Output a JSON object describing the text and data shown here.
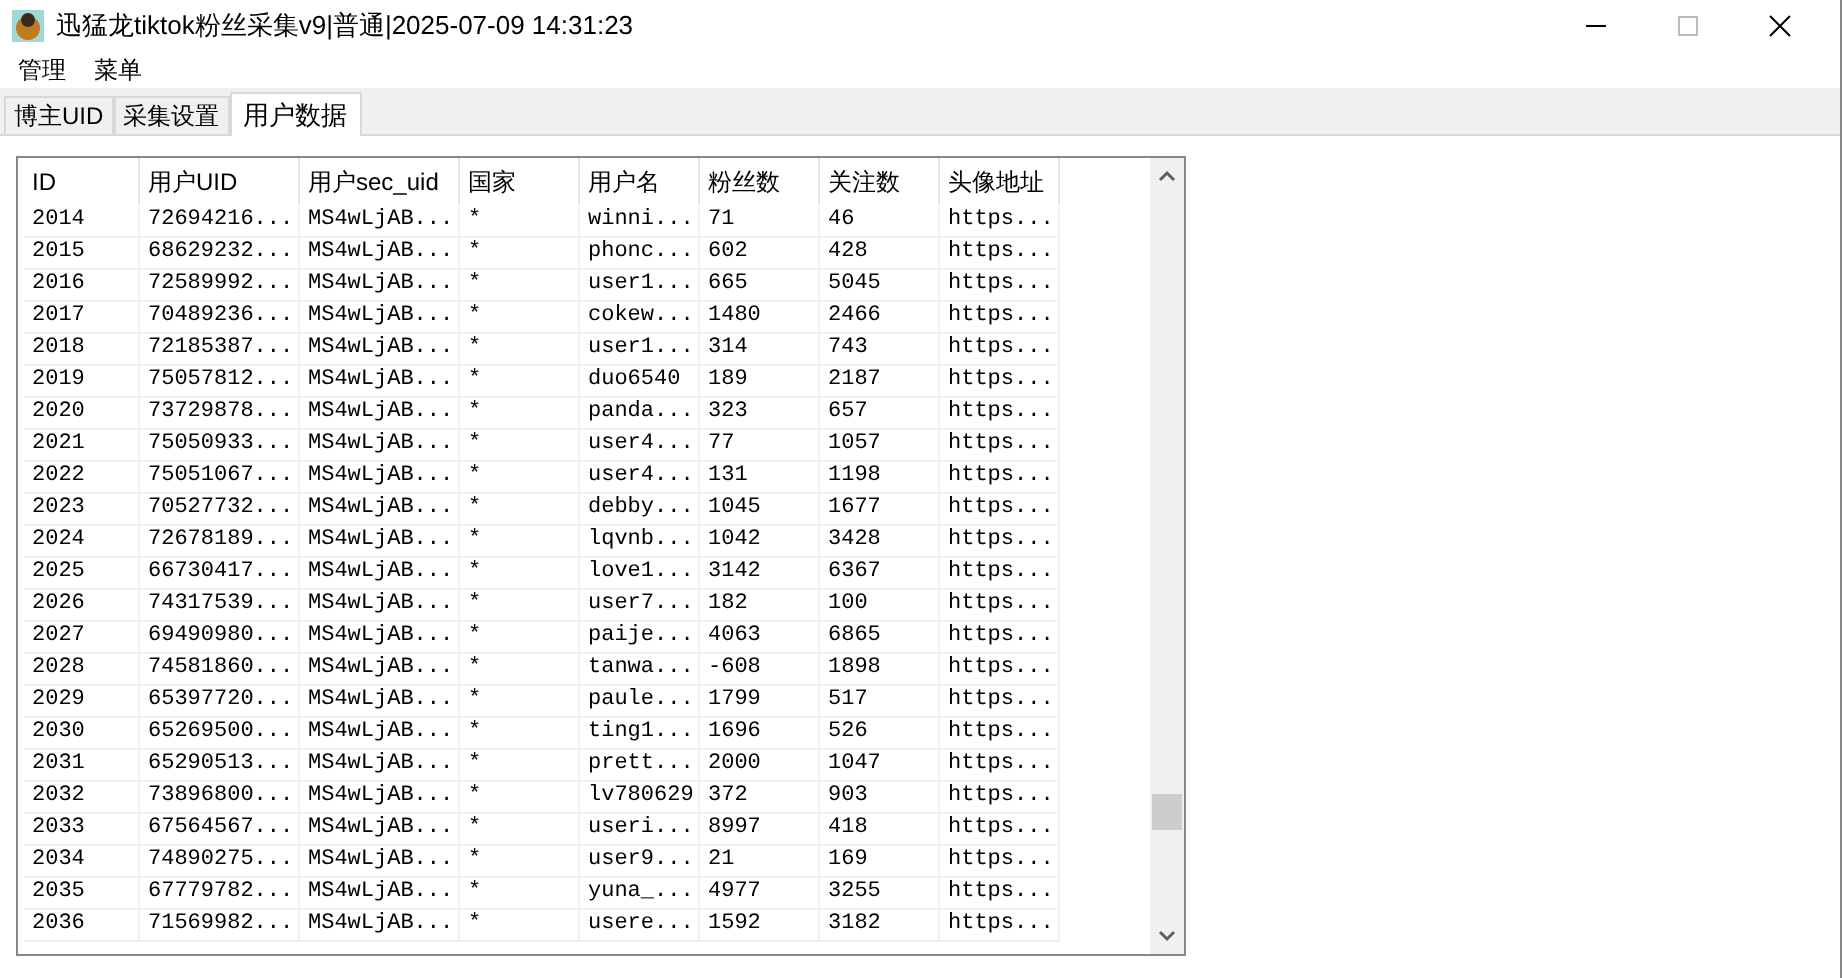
{
  "window": {
    "title": "迅猛龙tiktok粉丝采集v9|普通|2025-07-09 14:31:23"
  },
  "menu": [
    "管理",
    "菜单"
  ],
  "tabs": [
    {
      "label": "博主UID",
      "selected": false
    },
    {
      "label": "采集设置",
      "selected": false
    },
    {
      "label": "用户数据",
      "selected": true
    }
  ],
  "table": {
    "columns": [
      "ID",
      "用户UID",
      "用户sec_uid",
      "国家",
      "用户名",
      "粉丝数",
      "关注数",
      "头像地址"
    ],
    "rows": [
      [
        "2014",
        "72694216...",
        "MS4wLjAB...",
        "*",
        "winni...",
        "71",
        "46",
        "https..."
      ],
      [
        "2015",
        "68629232...",
        "MS4wLjAB...",
        "*",
        "phonc...",
        "602",
        "428",
        "https..."
      ],
      [
        "2016",
        "72589992...",
        "MS4wLjAB...",
        "*",
        "user1...",
        "665",
        "5045",
        "https..."
      ],
      [
        "2017",
        "70489236...",
        "MS4wLjAB...",
        "*",
        "cokew...",
        "1480",
        "2466",
        "https..."
      ],
      [
        "2018",
        "72185387...",
        "MS4wLjAB...",
        "*",
        "user1...",
        "314",
        "743",
        "https..."
      ],
      [
        "2019",
        "75057812...",
        "MS4wLjAB...",
        "*",
        "duo6540",
        "189",
        "2187",
        "https..."
      ],
      [
        "2020",
        "73729878...",
        "MS4wLjAB...",
        "*",
        "panda...",
        "323",
        "657",
        "https..."
      ],
      [
        "2021",
        "75050933...",
        "MS4wLjAB...",
        "*",
        "user4...",
        "77",
        "1057",
        "https..."
      ],
      [
        "2022",
        "75051067...",
        "MS4wLjAB...",
        "*",
        "user4...",
        "131",
        "1198",
        "https..."
      ],
      [
        "2023",
        "70527732...",
        "MS4wLjAB...",
        "*",
        "debby...",
        "1045",
        "1677",
        "https..."
      ],
      [
        "2024",
        "72678189...",
        "MS4wLjAB...",
        "*",
        "lqvnb...",
        "1042",
        "3428",
        "https..."
      ],
      [
        "2025",
        "66730417...",
        "MS4wLjAB...",
        "*",
        "love1...",
        "3142",
        "6367",
        "https..."
      ],
      [
        "2026",
        "74317539...",
        "MS4wLjAB...",
        "*",
        "user7...",
        "182",
        "100",
        "https..."
      ],
      [
        "2027",
        "69490980...",
        "MS4wLjAB...",
        "*",
        "paije...",
        "4063",
        "6865",
        "https..."
      ],
      [
        "2028",
        "74581860...",
        "MS4wLjAB...",
        "*",
        "tanwa...",
        "-608",
        "1898",
        "https..."
      ],
      [
        "2029",
        "65397720...",
        "MS4wLjAB...",
        "*",
        "paule...",
        "1799",
        "517",
        "https..."
      ],
      [
        "2030",
        "65269500...",
        "MS4wLjAB...",
        "*",
        "ting1...",
        "1696",
        "526",
        "https..."
      ],
      [
        "2031",
        "65290513...",
        "MS4wLjAB...",
        "*",
        "prett...",
        "2000",
        "1047",
        "https..."
      ],
      [
        "2032",
        "73896800...",
        "MS4wLjAB...",
        "*",
        "lv780629",
        "372",
        "903",
        "https..."
      ],
      [
        "2033",
        "67564567...",
        "MS4wLjAB...",
        "*",
        "useri...",
        "8997",
        "418",
        "https..."
      ],
      [
        "2034",
        "74890275...",
        "MS4wLjAB...",
        "*",
        "user9...",
        "21",
        "169",
        "https..."
      ],
      [
        "2035",
        "67779782...",
        "MS4wLjAB...",
        "*",
        "yuna_...",
        "4977",
        "3255",
        "https..."
      ],
      [
        "2036",
        "71569982...",
        "MS4wLjAB...",
        "*",
        "usere...",
        "1592",
        "3182",
        "https..."
      ]
    ]
  }
}
